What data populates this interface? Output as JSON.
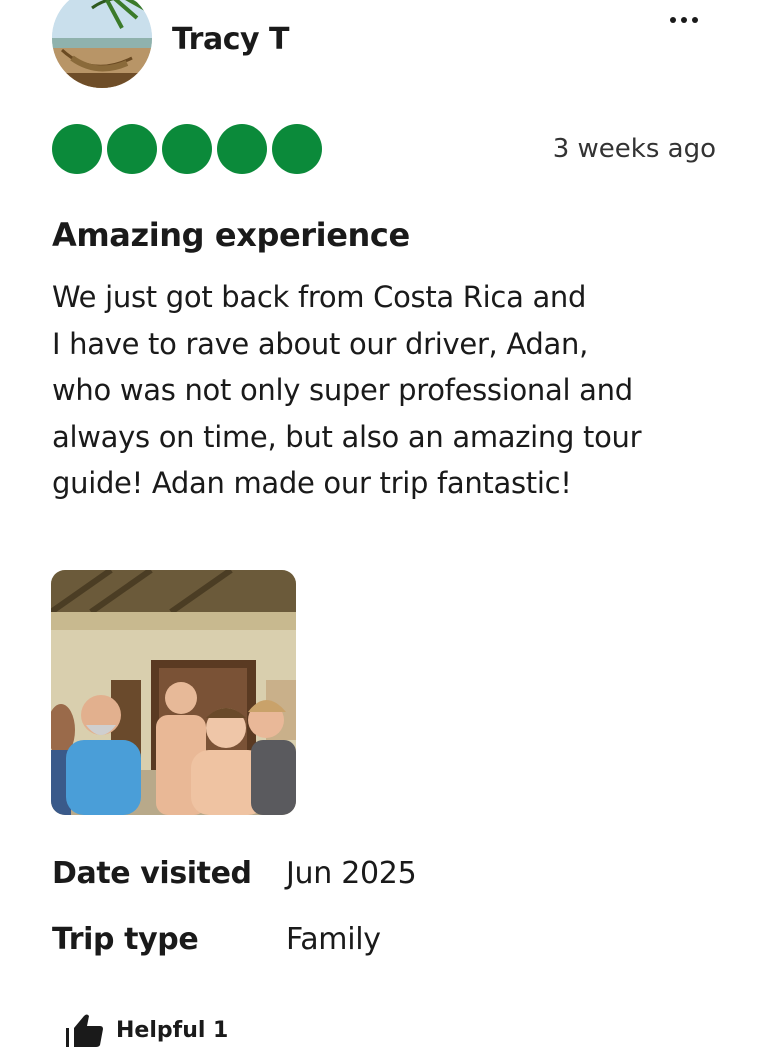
{
  "reviewer": {
    "name": "Tracy T",
    "avatar_icon": "beach-hammock-photo"
  },
  "menu": {
    "icon": "more-options-icon"
  },
  "rating": {
    "value": 5,
    "max": 5,
    "color": "#0b8a3a"
  },
  "review": {
    "date": "3 weeks ago",
    "title": "Amazing experience",
    "body_lines": [
      "We just got back from Costa Rica and",
      "I have to rave about our driver, Adan,",
      "who was not only super professional and",
      "always on time, but also an amazing tour",
      "guide! Adan made our trip fantastic!"
    ],
    "photo_icon": "family-group-photo"
  },
  "details": {
    "date_visited_label": "Date visited",
    "date_visited_value": "Jun 2025",
    "trip_type_label": "Trip type",
    "trip_type_value": "Family"
  },
  "helpful": {
    "label": "Helpful 1",
    "icon": "thumbs-up-icon"
  }
}
